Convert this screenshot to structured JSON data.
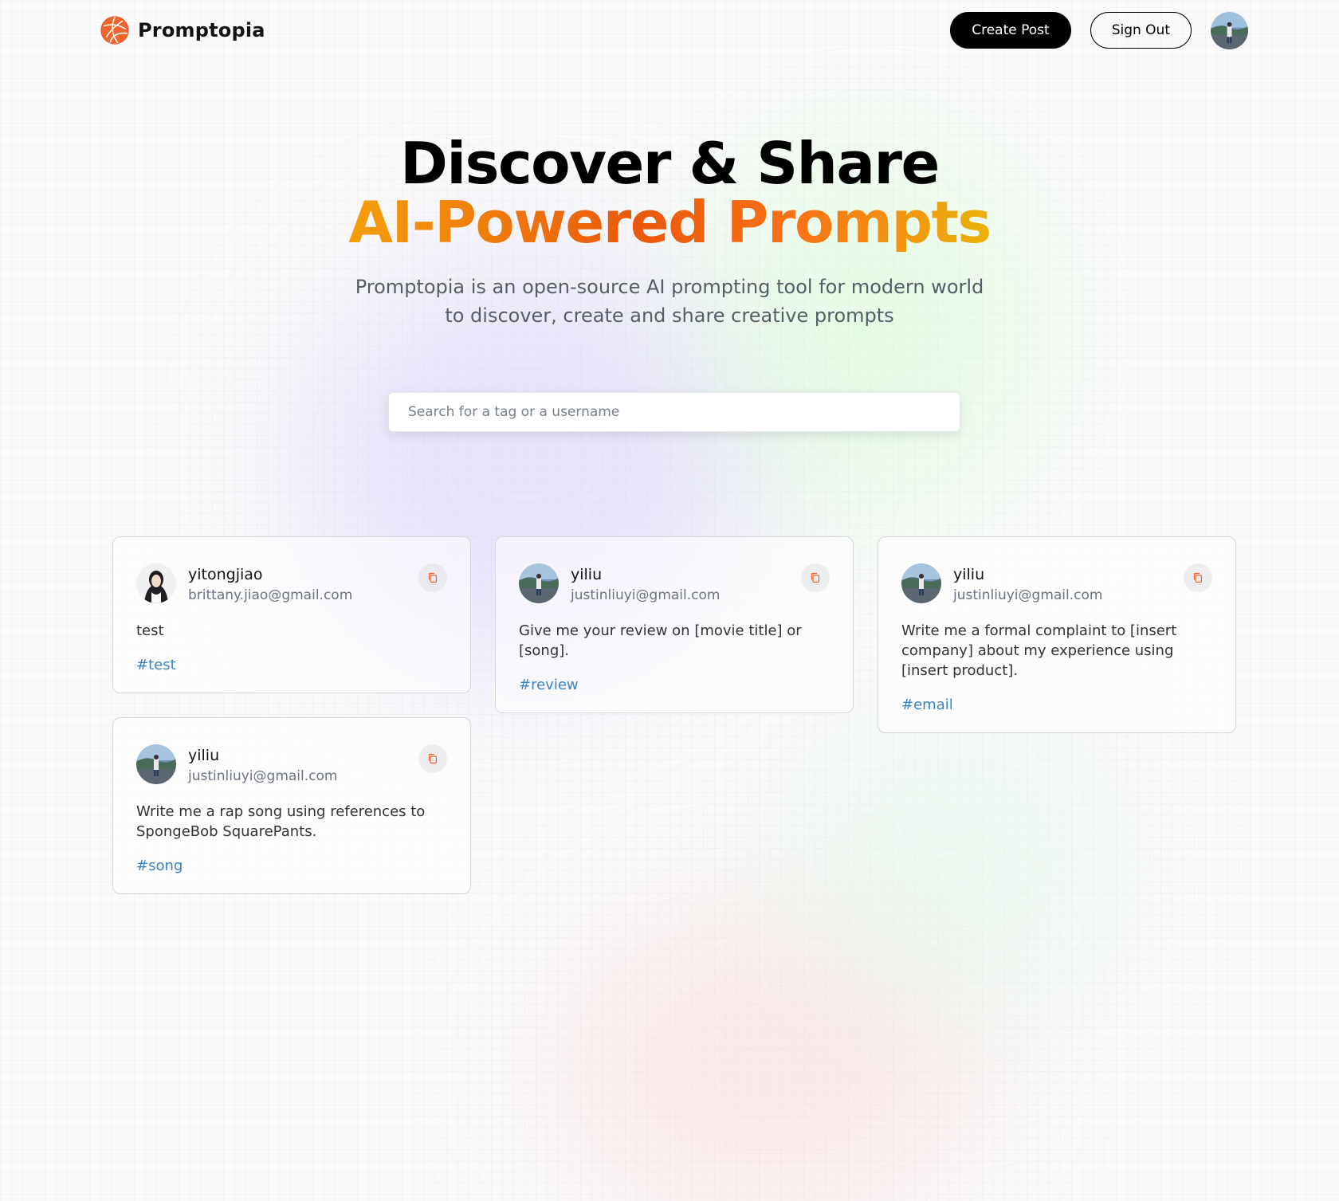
{
  "nav": {
    "brand": "Promptopia",
    "create_post": "Create Post",
    "sign_out": "Sign Out"
  },
  "hero": {
    "title_line1": "Discover & Share",
    "title_line2": "AI-Powered Prompts",
    "description": "Promptopia is an open-source AI prompting tool for modern world to discover, create and share creative prompts"
  },
  "search": {
    "placeholder": "Search for a tag or a username",
    "value": ""
  },
  "colors": {
    "accent_orange": "#ea580c",
    "tag_blue": "#3b82c4",
    "button_black": "#000000"
  },
  "icons": {
    "logo": "promptopia-logo-icon",
    "copy": "copy-icon"
  },
  "posts": [
    {
      "username": "yitongjiao",
      "email": "brittany.jiao@gmail.com",
      "prompt": "test",
      "tag": "#test"
    },
    {
      "username": "yiliu",
      "email": "justinliuyi@gmail.com",
      "prompt": "Give me your review on [movie title] or [song].",
      "tag": "#review"
    },
    {
      "username": "yiliu",
      "email": "justinliuyi@gmail.com",
      "prompt": "Write me a formal complaint to [insert company] about my experience using [insert product].",
      "tag": "#email"
    },
    {
      "username": "yiliu",
      "email": "justinliuyi@gmail.com",
      "prompt": "Write me a rap song using references to SpongeBob SquarePants.",
      "tag": "#song"
    }
  ]
}
